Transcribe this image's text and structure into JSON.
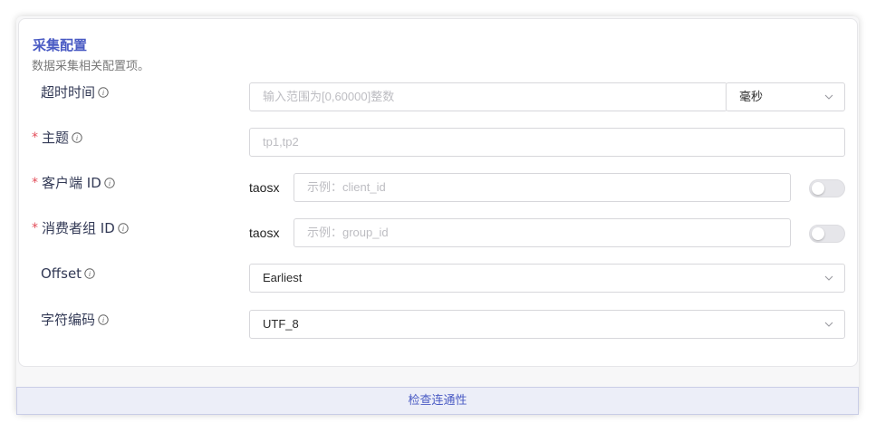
{
  "section": {
    "title": "采集配置",
    "description": "数据采集相关配置项。"
  },
  "fields": {
    "timeout": {
      "label": "超时时间",
      "required": false,
      "placeholder": "输入范围为[0,60000]整数",
      "unit": "毫秒"
    },
    "topic": {
      "label": "主题",
      "required": true,
      "placeholder": "tp1,tp2"
    },
    "client_id": {
      "label": "客户端 ID",
      "required": true,
      "prefix": "taosx",
      "placeholder": "示例：client_id",
      "toggle_on": false
    },
    "group_id": {
      "label": "消费者组 ID",
      "required": true,
      "prefix": "taosx",
      "placeholder": "示例：group_id",
      "toggle_on": false
    },
    "offset": {
      "label": "Offset",
      "required": false,
      "value": "Earliest"
    },
    "encoding": {
      "label": "字符编码",
      "required": false,
      "value": "UTF_8"
    }
  },
  "required_mark": "*",
  "check_button": "检查连通性",
  "colors": {
    "accent": "#4a5bc4",
    "required": "#e34d59",
    "label": "#333a56"
  }
}
